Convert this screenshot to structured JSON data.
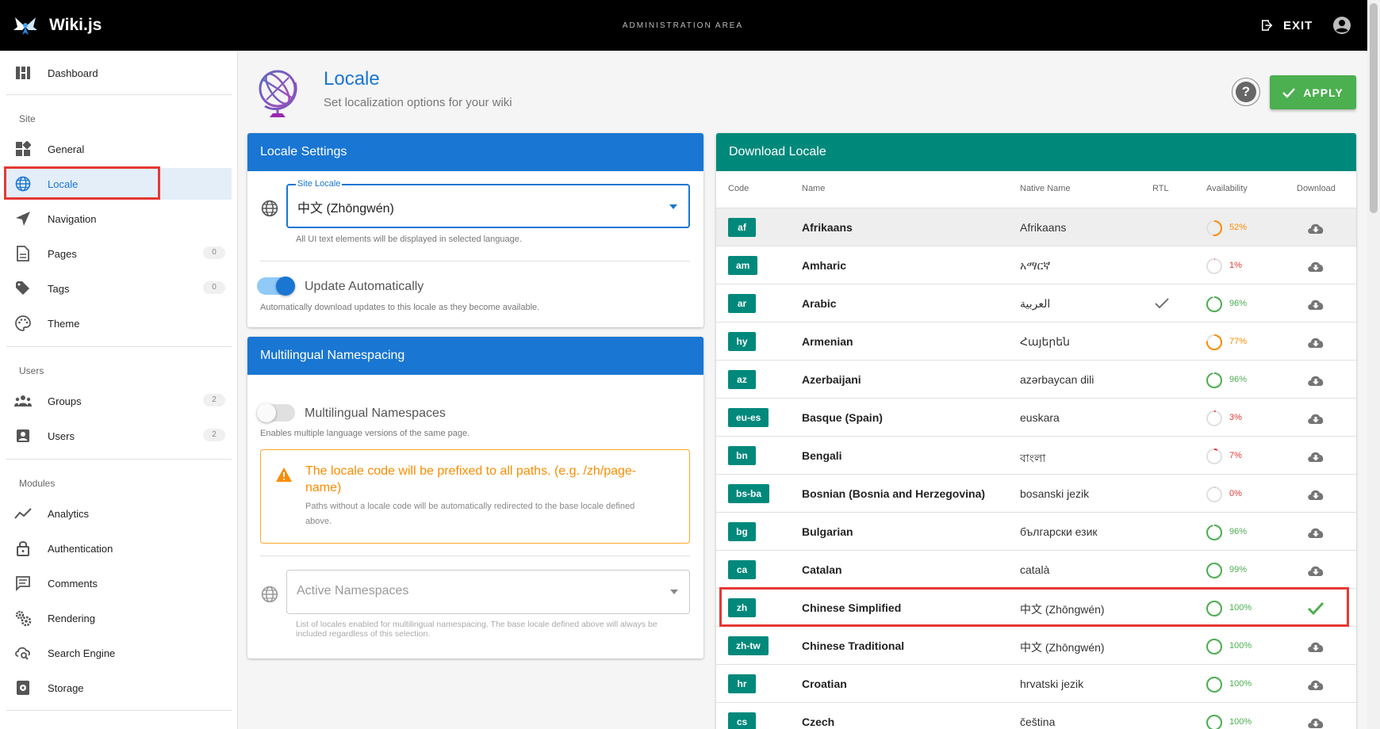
{
  "app": {
    "name": "Wiki.js",
    "area_label": "ADMINISTRATION AREA",
    "exit_label": "EXIT"
  },
  "sidebar": {
    "dashboard": "Dashboard",
    "site_header": "Site",
    "users_header": "Users",
    "modules_header": "Modules",
    "items": {
      "general": "General",
      "locale": "Locale",
      "navigation": "Navigation",
      "pages": "Pages",
      "pages_count": "0",
      "tags": "Tags",
      "tags_count": "0",
      "theme": "Theme",
      "groups": "Groups",
      "groups_count": "2",
      "users": "Users",
      "users_count": "2",
      "analytics": "Analytics",
      "authentication": "Authentication",
      "comments": "Comments",
      "rendering": "Rendering",
      "search_engine": "Search Engine",
      "storage": "Storage"
    }
  },
  "header": {
    "title": "Locale",
    "subtitle": "Set localization options for your wiki",
    "apply_label": "APPLY",
    "help_label": "?"
  },
  "locale_settings": {
    "title": "Locale Settings",
    "site_locale_label": "Site Locale",
    "site_locale_value": "中文 (Zhōngwén)",
    "site_locale_hint": "All UI text elements will be displayed in selected language.",
    "update_label": "Update Automatically",
    "update_enabled": true,
    "update_hint": "Automatically download updates to this locale as they become available."
  },
  "namespacing": {
    "title": "Multilingual Namespacing",
    "toggle_label": "Multilingual Namespaces",
    "toggle_enabled": false,
    "toggle_hint": "Enables multiple language versions of the same page.",
    "alert_title": "The locale code will be prefixed to all paths. (e.g. /zh/page-name)",
    "alert_text": "Paths without a locale code will be automatically redirected to the base locale defined above.",
    "active_placeholder": "Active Namespaces",
    "active_hint": "List of locales enabled for multilingual namespacing. The base locale defined above will always be included regardless of this selection."
  },
  "download": {
    "title": "Download Locale",
    "headers": {
      "code": "Code",
      "name": "Name",
      "native": "Native Name",
      "rtl": "RTL",
      "availability": "Availability",
      "download": "Download"
    },
    "colors": {
      "complete": "#4caf50",
      "partial": "#fb8c00",
      "low": "#e53935",
      "icon": "#757575"
    },
    "rows": [
      {
        "code": "af",
        "name": "Afrikaans",
        "native": "Afrikaans",
        "rtl": false,
        "availability": 52,
        "pct": "52%",
        "installed": false
      },
      {
        "code": "am",
        "name": "Amharic",
        "native": "አማርኛ",
        "rtl": false,
        "availability": 1,
        "pct": "1%",
        "installed": false
      },
      {
        "code": "ar",
        "name": "Arabic",
        "native": "العربية",
        "rtl": true,
        "availability": 96,
        "pct": "96%",
        "installed": false
      },
      {
        "code": "hy",
        "name": "Armenian",
        "native": "Հայերեն",
        "rtl": false,
        "availability": 77,
        "pct": "77%",
        "installed": false
      },
      {
        "code": "az",
        "name": "Azerbaijani",
        "native": "azərbaycan dili",
        "rtl": false,
        "availability": 96,
        "pct": "96%",
        "installed": false
      },
      {
        "code": "eu-es",
        "name": "Basque (Spain)",
        "native": "euskara",
        "rtl": false,
        "availability": 3,
        "pct": "3%",
        "installed": false
      },
      {
        "code": "bn",
        "name": "Bengali",
        "native": "বাংলা",
        "rtl": false,
        "availability": 7,
        "pct": "7%",
        "installed": false
      },
      {
        "code": "bs-ba",
        "name": "Bosnian (Bosnia and Herzegovina)",
        "native": "bosanski jezik",
        "rtl": false,
        "availability": 0,
        "pct": "0%",
        "installed": false
      },
      {
        "code": "bg",
        "name": "Bulgarian",
        "native": "български език",
        "rtl": false,
        "availability": 96,
        "pct": "96%",
        "installed": false
      },
      {
        "code": "ca",
        "name": "Catalan",
        "native": "català",
        "rtl": false,
        "availability": 99,
        "pct": "99%",
        "installed": false
      },
      {
        "code": "zh",
        "name": "Chinese Simplified",
        "native": "中文 (Zhōngwén)",
        "rtl": false,
        "availability": 100,
        "pct": "100%",
        "installed": true
      },
      {
        "code": "zh-tw",
        "name": "Chinese Traditional",
        "native": "中文 (Zhōngwén)",
        "rtl": false,
        "availability": 100,
        "pct": "100%",
        "installed": false
      },
      {
        "code": "hr",
        "name": "Croatian",
        "native": "hrvatski jezik",
        "rtl": false,
        "availability": 100,
        "pct": "100%",
        "installed": false
      },
      {
        "code": "cs",
        "name": "Czech",
        "native": "čeština",
        "rtl": false,
        "availability": 100,
        "pct": "100%",
        "installed": false
      }
    ]
  }
}
